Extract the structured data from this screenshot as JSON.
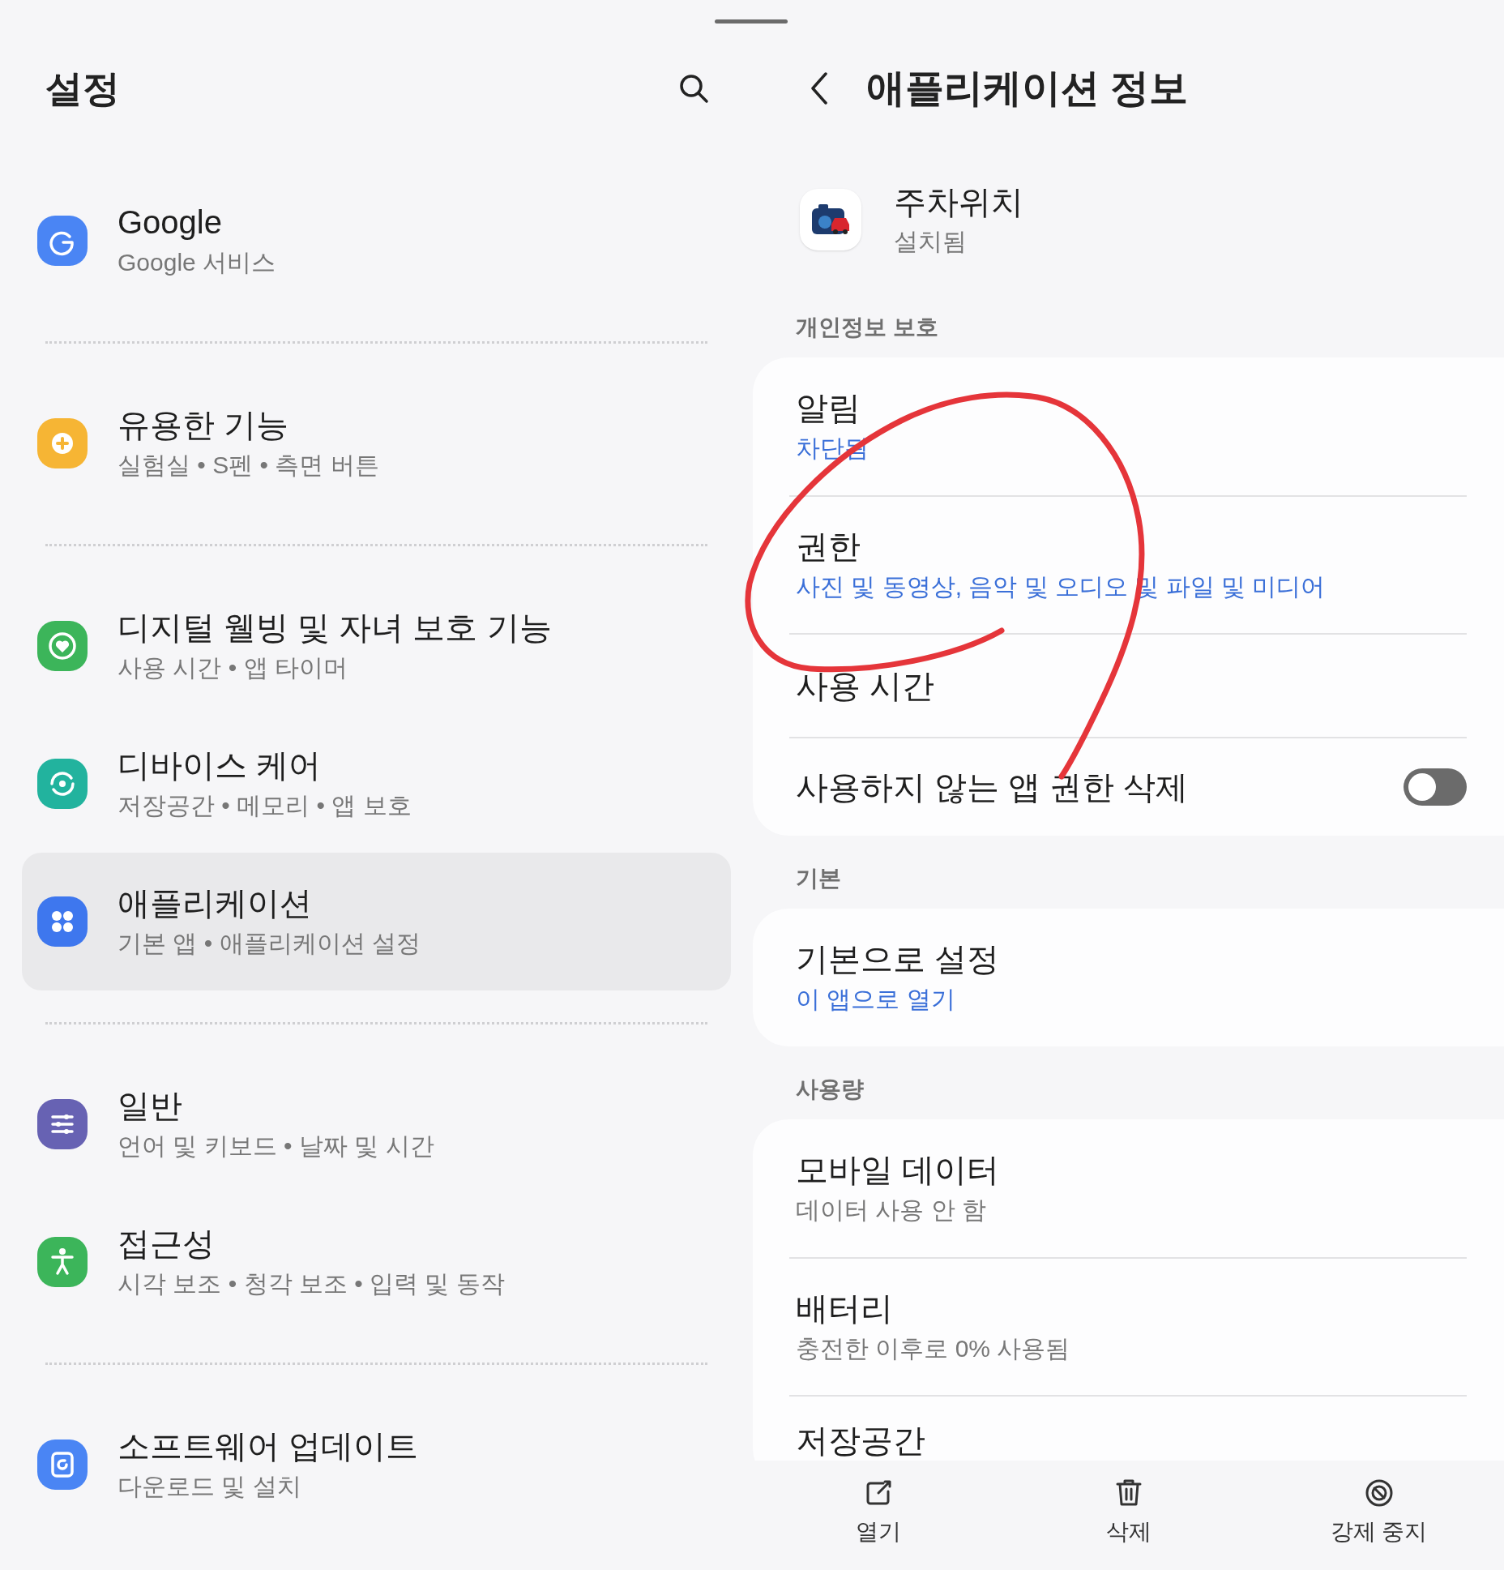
{
  "settings": {
    "title": "설정",
    "groups": [
      [
        {
          "title": "Google",
          "subtitle": "Google 서비스",
          "color": "#4a85f4",
          "selected": false
        }
      ],
      [
        {
          "title": "유용한 기능",
          "subtitle": "실험실 • S펜 • 측면 버튼",
          "color": "#f6b534",
          "selected": false
        }
      ],
      [
        {
          "title": "디지털 웰빙 및 자녀 보호 기능",
          "subtitle": "사용 시간 • 앱 타이머",
          "color": "#3cb55a",
          "selected": false
        },
        {
          "title": "디바이스 케어",
          "subtitle": "저장공간 • 메모리 • 앱 보호",
          "color": "#22b39e",
          "selected": false
        },
        {
          "title": "애플리케이션",
          "subtitle": "기본 앱 • 애플리케이션 설정",
          "color": "#3e77ee",
          "selected": true
        }
      ],
      [
        {
          "title": "일반",
          "subtitle": "언어 및 키보드 • 날짜 및 시간",
          "color": "#6762b3",
          "selected": false
        },
        {
          "title": "접근성",
          "subtitle": "시각 보조 • 청각 보조 • 입력 및 동작",
          "color": "#3cb55a",
          "selected": false
        }
      ],
      [
        {
          "title": "소프트웨어 업데이트",
          "subtitle": "다운로드 및 설치",
          "color": "#4a85f4",
          "selected": false
        }
      ]
    ]
  },
  "app_info": {
    "title": "애플리케이션 정보",
    "app": {
      "name": "주차위치",
      "status": "설치됨"
    },
    "sections": [
      {
        "label": "개인정보 보호",
        "items": [
          {
            "kind": "accent",
            "title": "알림",
            "value": "차단됨"
          },
          {
            "kind": "accent",
            "title": "권한",
            "value": "사진 및 동영상, 음악 및 오디오 및 파일 및 미디어"
          },
          {
            "kind": "single",
            "title": "사용 시간"
          },
          {
            "kind": "toggle",
            "title": "사용하지 않는 앱 권한 삭제",
            "on": false
          }
        ]
      },
      {
        "label": "기본",
        "items": [
          {
            "kind": "accent",
            "title": "기본으로 설정",
            "value": "이 앱으로 열기"
          }
        ]
      },
      {
        "label": "사용량",
        "items": [
          {
            "kind": "detail",
            "title": "모바일 데이터",
            "value": "데이터 사용 안 함"
          },
          {
            "kind": "detail",
            "title": "배터리",
            "value": "충전한 이후로 0% 사용됨"
          },
          {
            "kind": "cut",
            "title": "저장공간"
          }
        ]
      }
    ],
    "actions": [
      {
        "label": "열기"
      },
      {
        "label": "삭제"
      },
      {
        "label": "강제 중지"
      }
    ]
  }
}
